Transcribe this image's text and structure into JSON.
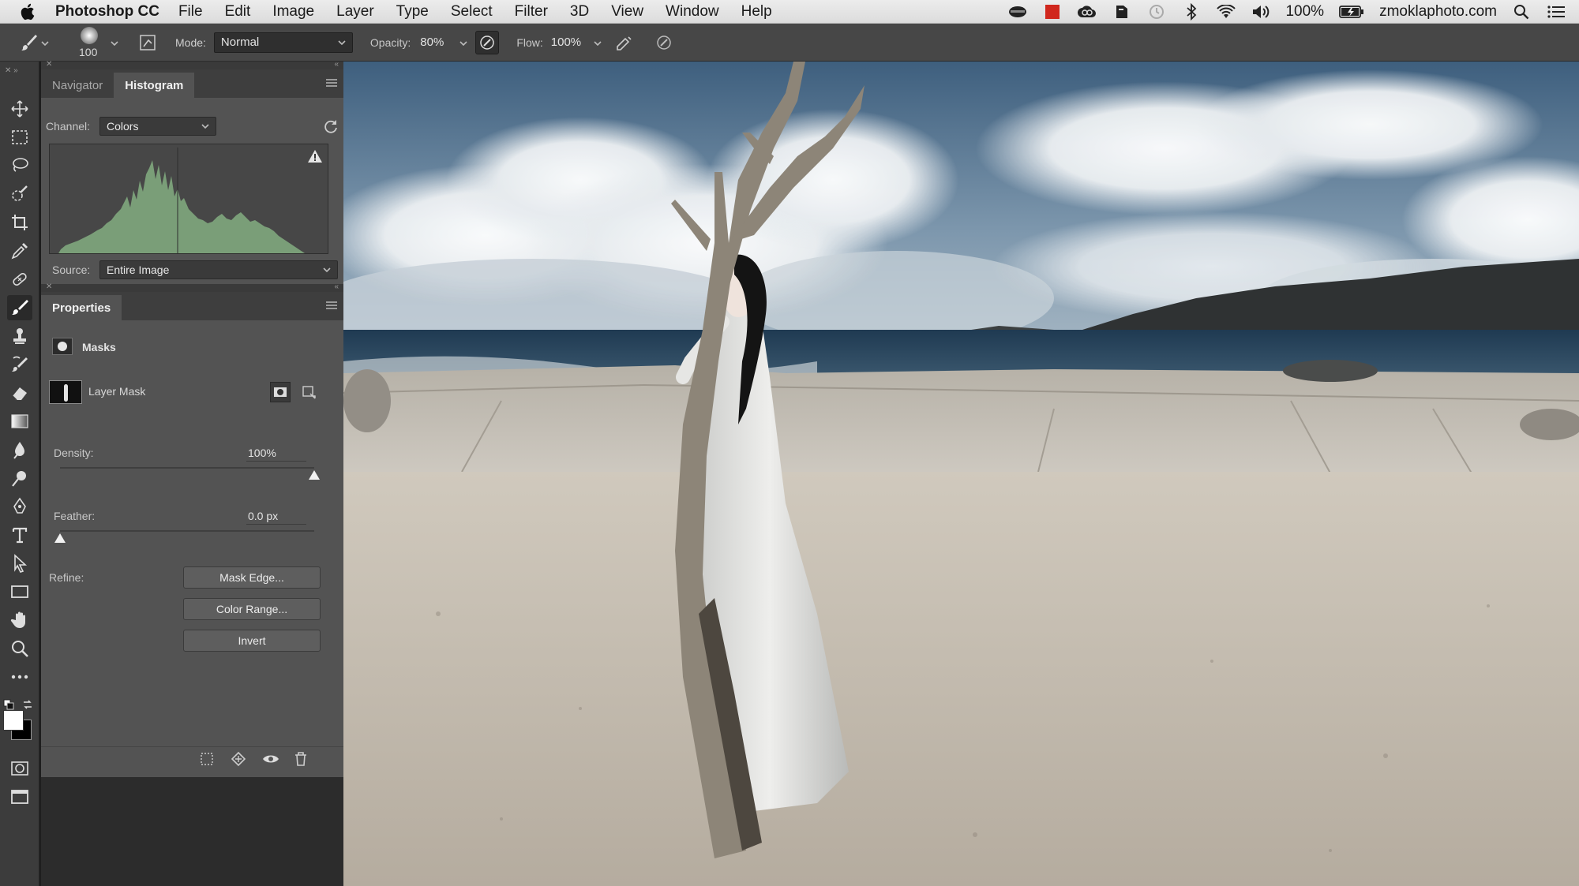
{
  "menubar": {
    "app_name": "Photoshop CC",
    "items": [
      "File",
      "Edit",
      "Image",
      "Layer",
      "Type",
      "Select",
      "Filter",
      "3D",
      "View",
      "Window",
      "Help"
    ],
    "battery": "100%",
    "website": "zmoklaphoto.com"
  },
  "options_bar": {
    "brush_size": "100",
    "mode_label": "Mode:",
    "mode_value": "Normal",
    "opacity_label": "Opacity:",
    "opacity_value": "80%",
    "flow_label": "Flow:",
    "flow_value": "100%"
  },
  "histogram_panel": {
    "tabs": [
      "Navigator",
      "Histogram"
    ],
    "active_tab": "Histogram",
    "channel_label": "Channel:",
    "channel_value": "Colors",
    "source_label": "Source:",
    "source_value": "Entire Image"
  },
  "properties_panel": {
    "title": "Properties",
    "section": "Masks",
    "layer_mask_label": "Layer Mask",
    "density_label": "Density:",
    "density_value": "100%",
    "density_level": 1.0,
    "feather_label": "Feather:",
    "feather_value": "0.0 px",
    "feather_level": 0.0,
    "refine_label": "Refine:",
    "buttons": {
      "mask_edge": "Mask Edge...",
      "color_range": "Color Range...",
      "invert": "Invert"
    }
  },
  "colors": {
    "foreground": "#ffffff",
    "background": "#000000",
    "histogram_fill": "#7a9e78"
  },
  "icons": {
    "apple": "apple-icon",
    "search": "search-icon",
    "list": "list-icon",
    "wifi": "wifi-icon",
    "bluetooth": "bluetooth-icon",
    "volume": "volume-icon",
    "battery": "battery-icon",
    "warning": "warning-icon",
    "refresh": "refresh-icon"
  }
}
